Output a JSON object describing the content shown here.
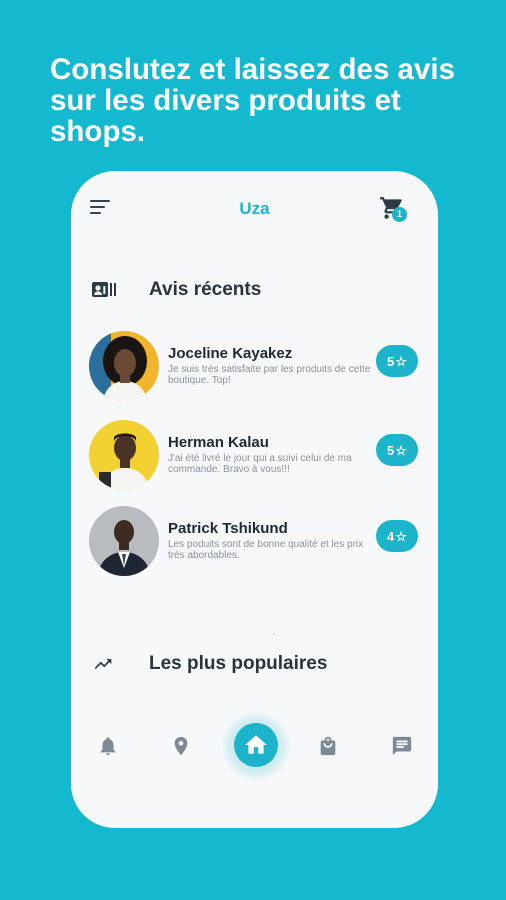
{
  "headline": "Conslutez et laissez des avis sur les divers produits et shops.",
  "header": {
    "title": "Uza",
    "cart_count": "1",
    "menu_icon": "hamburger-menu-icon",
    "cart_icon": "shopping-cart-icon"
  },
  "recent_reviews": {
    "title": "Avis récents",
    "icon": "contact-card-icon",
    "items": [
      {
        "name": "Joceline Kayakez",
        "text": "Je suis très satisfaite par les produits de cette boutique. Top!",
        "rating": "5"
      },
      {
        "name": "Herman Kalau",
        "text": "J'ai été livré le jour qui a suivi celui de ma commande. Bravo à vous!!!",
        "rating": "5"
      },
      {
        "name": "Patrick Tshikund",
        "text": "Les poduits sont de bonne qualité et les prix très abordables.",
        "rating": "4"
      }
    ]
  },
  "popular": {
    "title": "Les plus populaires",
    "icon": "trending-up-icon"
  },
  "bottom_nav": {
    "items": [
      "bell-icon",
      "location-pin-icon",
      "home-icon",
      "shopping-bag-icon",
      "chat-message-icon"
    ],
    "active": "home-icon"
  },
  "colors": {
    "background": "#14b8cf",
    "accent": "#1db4cb",
    "card": "#f7f8f9",
    "text_dark": "#2a343a",
    "icon_grey": "#7d8a96"
  }
}
